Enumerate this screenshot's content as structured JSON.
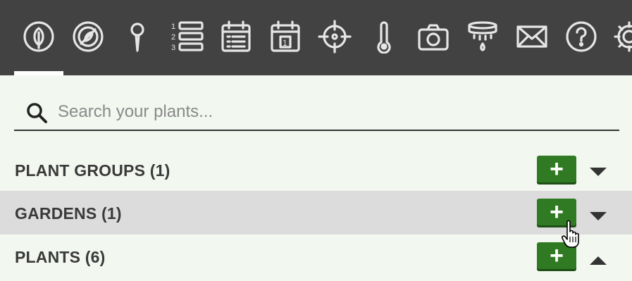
{
  "toolbar": {
    "icons": [
      {
        "name": "leaf-icon",
        "active": true
      },
      {
        "name": "no-plant-icon"
      },
      {
        "name": "map-pin-icon"
      },
      {
        "name": "numbered-list-icon"
      },
      {
        "name": "calendar-list-icon"
      },
      {
        "name": "calendar-day-icon",
        "day": "1"
      },
      {
        "name": "crosshair-icon"
      },
      {
        "name": "thermometer-icon"
      },
      {
        "name": "camera-icon"
      },
      {
        "name": "irrigation-icon"
      },
      {
        "name": "mail-icon"
      },
      {
        "name": "help-icon"
      },
      {
        "name": "settings-icon"
      }
    ]
  },
  "search": {
    "placeholder": "Search your plants..."
  },
  "sections": [
    {
      "label": "PLANT GROUPS (1)",
      "add": "+",
      "caret": "down"
    },
    {
      "label": "GARDENS (1)",
      "add": "+",
      "caret": "down",
      "hover": true
    },
    {
      "label": "PLANTS (6)",
      "add": "+",
      "caret": "up"
    }
  ],
  "colors": {
    "topbar": "#424242",
    "background": "#f2f7ef",
    "add_button": "#2f7a22",
    "hover_row": "#dcdcdc"
  }
}
